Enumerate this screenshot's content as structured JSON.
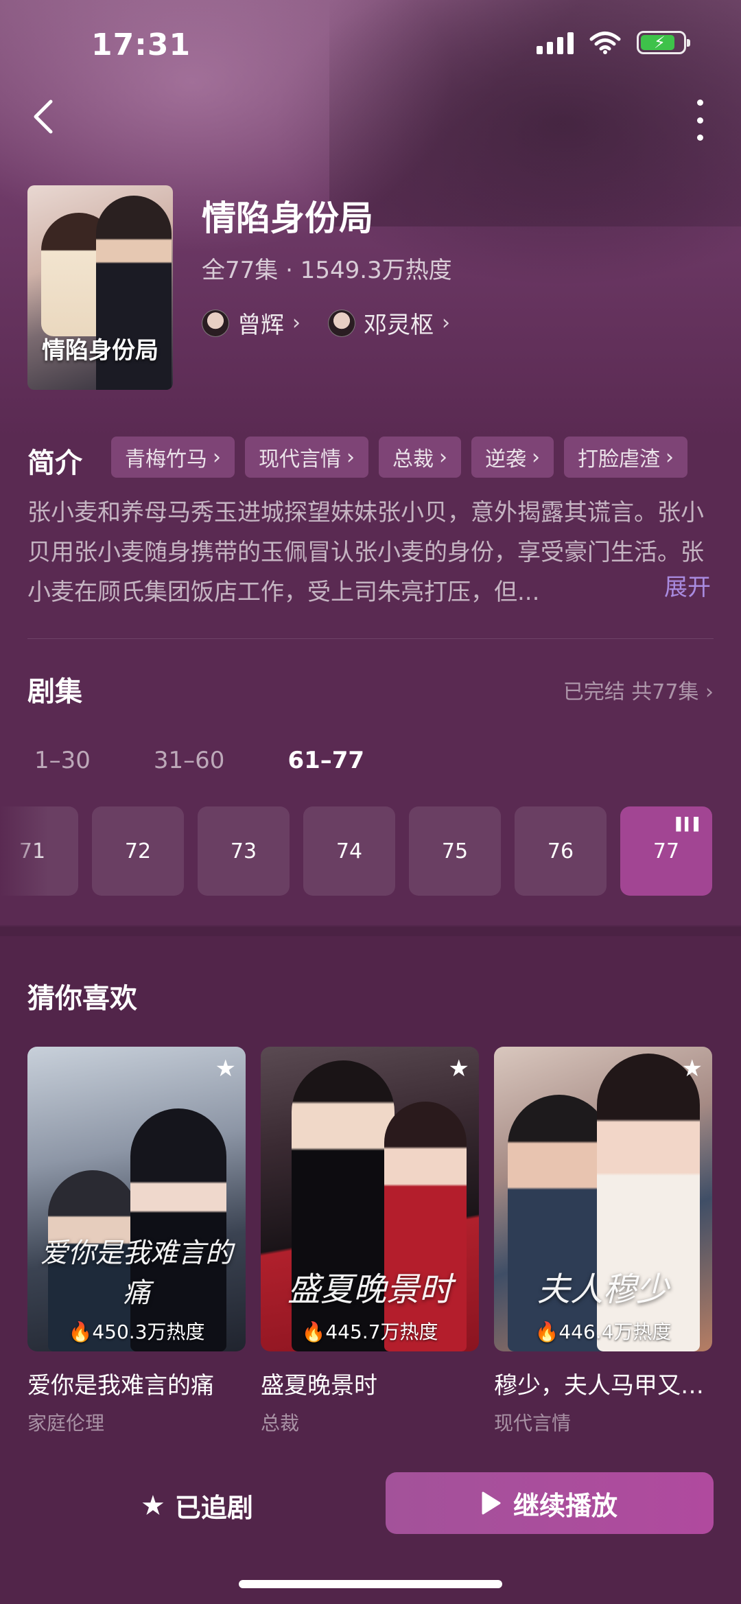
{
  "status_bar": {
    "time": "17:31"
  },
  "drama": {
    "title": "情陷身份局",
    "poster_title": "情陷身份局",
    "meta": "全77集 · 1549.3万热度",
    "actors": [
      "曾辉",
      "邓灵枢"
    ]
  },
  "synopsis": {
    "label": "简介",
    "tags": [
      "青梅竹马",
      "现代言情",
      "总裁",
      "逆袭",
      "打脸虐渣"
    ],
    "text": "张小麦和养母马秀玉进城探望妹妹张小贝，意外揭露其谎言。张小贝用张小麦随身携带的玉佩冒认张小麦的身份，享受豪门生活。张小麦在顾氏集团饭店工作，受上司朱亮打压，但...",
    "expand_label": "展开"
  },
  "episodes": {
    "label": "剧集",
    "status": "已完结 共77集",
    "ranges": [
      "1–30",
      "31–60",
      "61–77"
    ],
    "active_range": "61–77",
    "visible": [
      "71",
      "72",
      "73",
      "74",
      "75",
      "76",
      "77"
    ],
    "current": "77"
  },
  "recommendations": {
    "label": "猜你喜欢",
    "items": [
      {
        "name": "爱你是我难言的痛",
        "genre": "家庭伦理",
        "heat": "450.3万热度",
        "cover_text": "爱你是我难言的痛"
      },
      {
        "name": "盛夏晚景时",
        "genre": "总裁",
        "heat": "445.7万热度",
        "cover_text": "盛夏晚景时"
      },
      {
        "name": "穆少，夫人马甲又…",
        "genre": "现代言情",
        "heat": "446.4万热度",
        "cover_text": "夫人穆少"
      }
    ]
  },
  "actions": {
    "follow_label": "已追剧",
    "play_label": "继续播放"
  },
  "colors": {
    "background": "#5a2a52",
    "accent": "#a24593",
    "tag_bg": "#7a3d72",
    "expand_link": "#a98be0",
    "battery_green": "#3ec24a"
  },
  "icons": [
    "back-arrow-icon",
    "more-vertical-icon",
    "star-icon",
    "play-icon",
    "fire-icon",
    "chevron-right-icon",
    "wifi-icon",
    "signal-icon",
    "battery-icon",
    "now-playing-icon"
  ]
}
